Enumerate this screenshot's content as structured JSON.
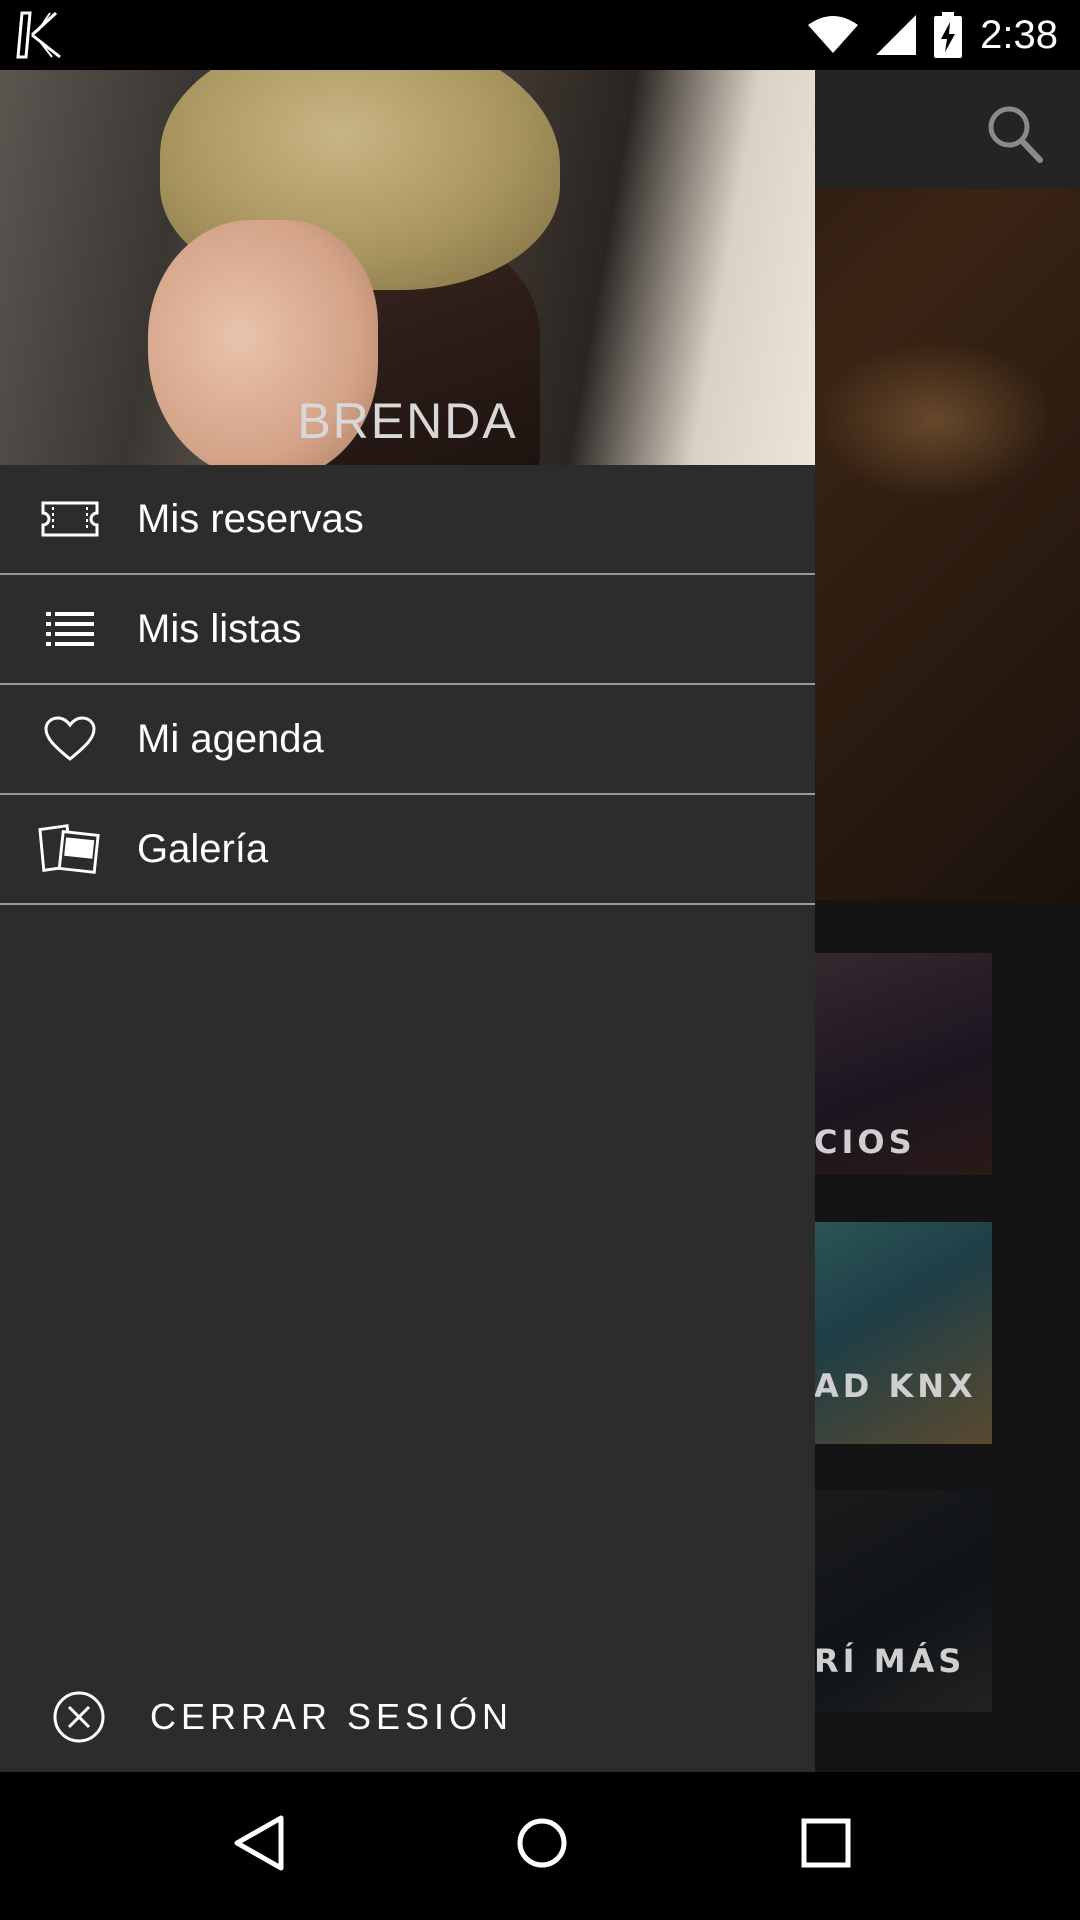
{
  "status_bar": {
    "time": "2:38",
    "icons": [
      "app-logo-icon",
      "wifi-icon",
      "signal-icon",
      "battery-charging-icon"
    ]
  },
  "background": {
    "cards": [
      {
        "label": "CIOS"
      },
      {
        "label": "AD KNX"
      },
      {
        "label": "RÍ MÁS"
      }
    ]
  },
  "drawer": {
    "header": {
      "user_name": "BRENDA"
    },
    "items": [
      {
        "label": "Mis reservas",
        "icon": "ticket-icon"
      },
      {
        "label": "Mis listas",
        "icon": "list-icon"
      },
      {
        "label": "Mi agenda",
        "icon": "heart-icon"
      },
      {
        "label": "Galería",
        "icon": "photos-icon"
      }
    ],
    "logout_label": "CERRAR SESIÓN"
  },
  "nav_bar": {
    "icons": [
      "back-icon",
      "home-icon",
      "recents-icon"
    ]
  },
  "colors": {
    "drawer_bg": "#2c2c2c",
    "divider": "#9a9a9a",
    "status_bar": "#000000"
  }
}
